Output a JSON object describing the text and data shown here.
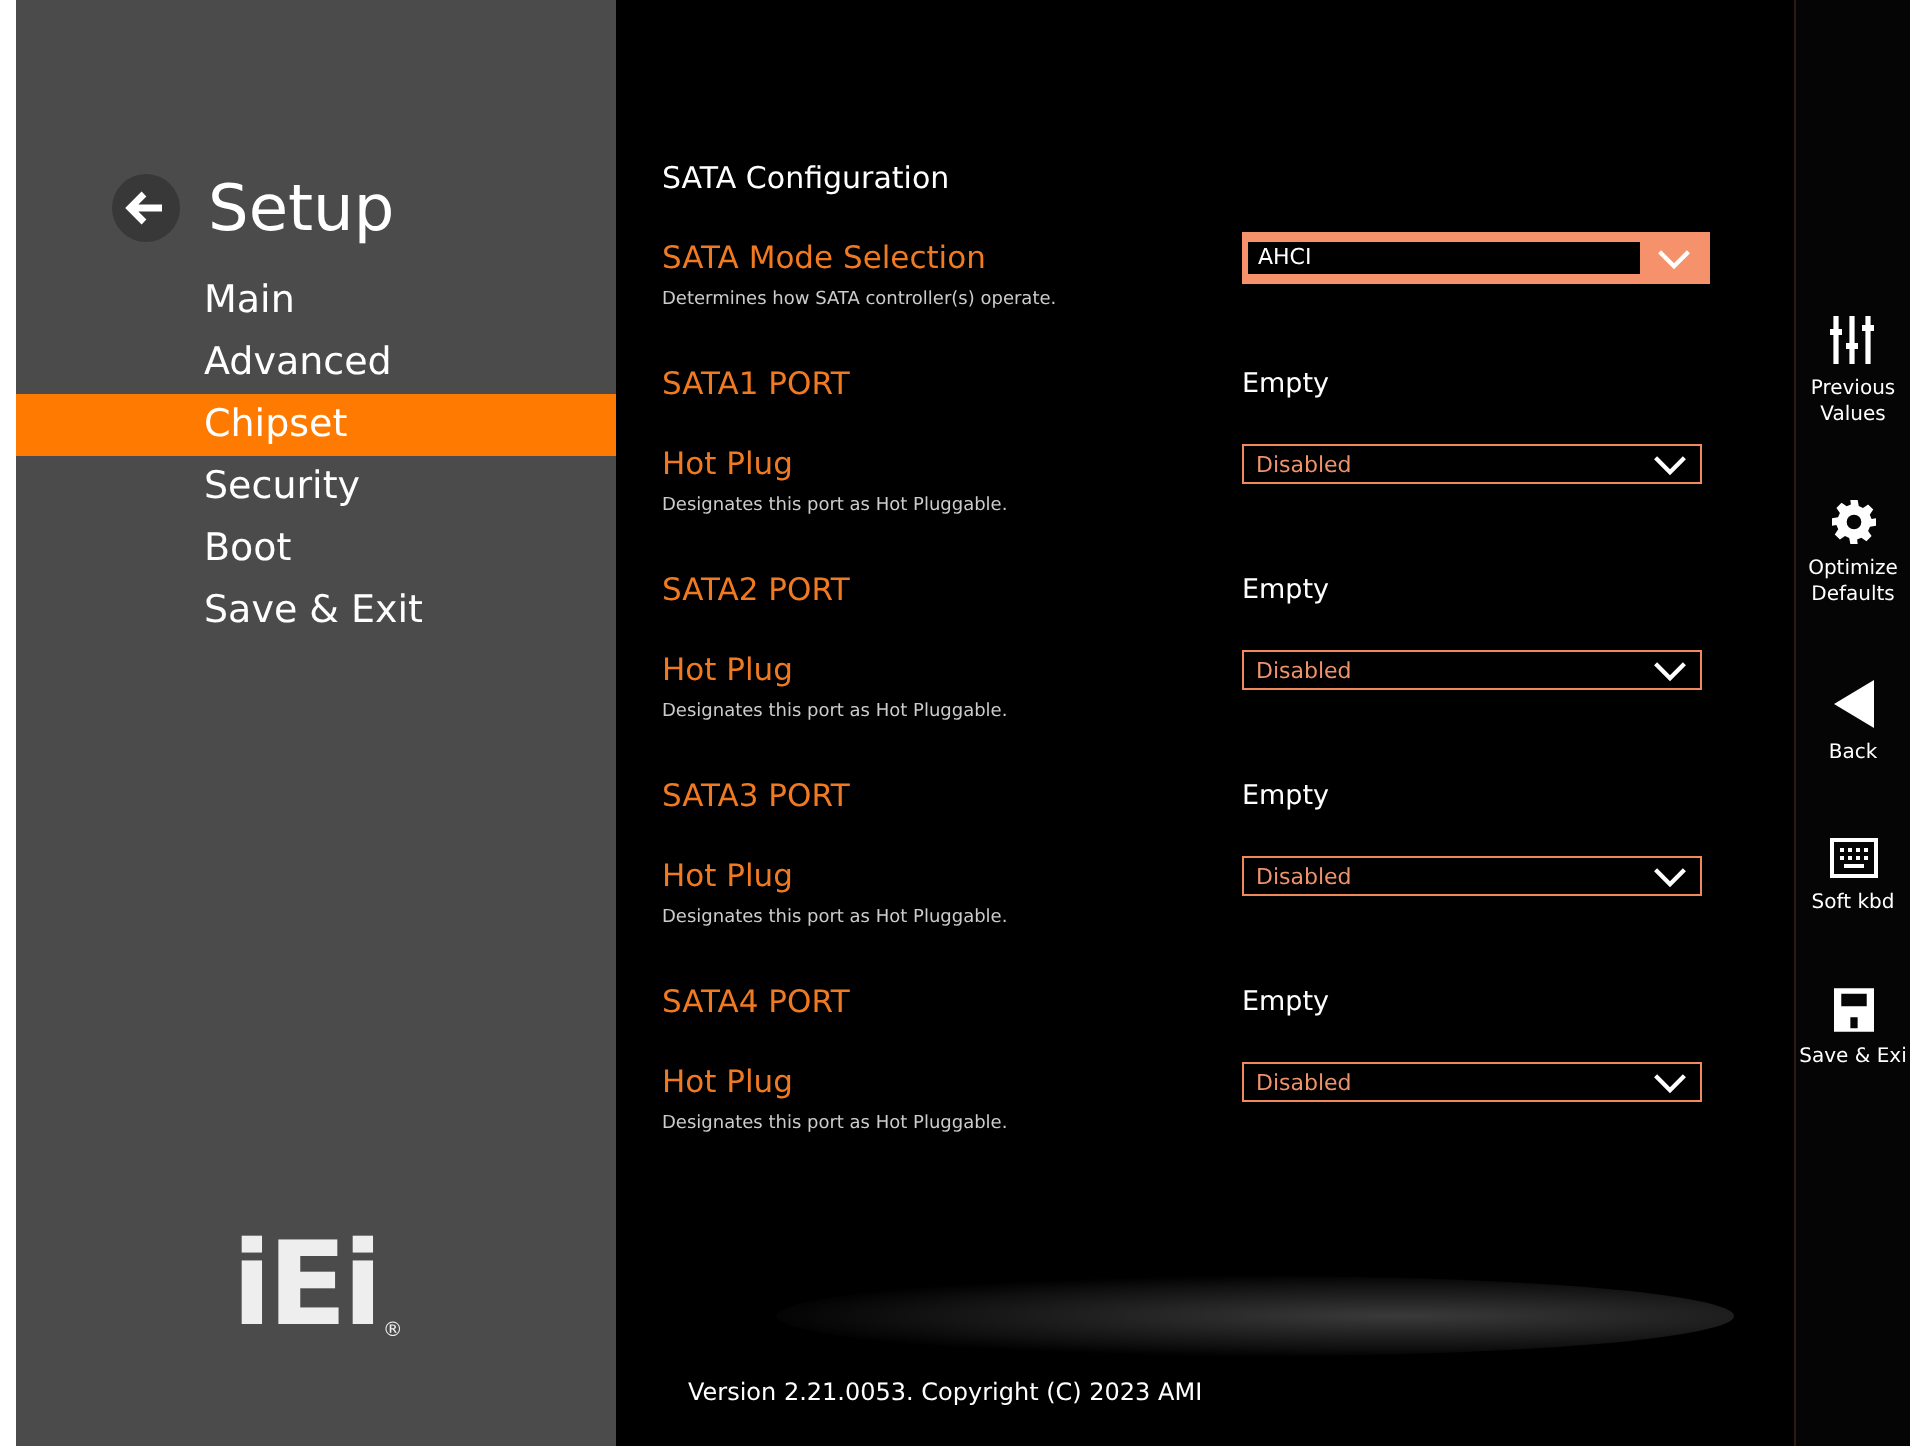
{
  "sidebar": {
    "title": "Setup",
    "items": [
      {
        "label": "Main",
        "selected": false
      },
      {
        "label": "Advanced",
        "selected": false
      },
      {
        "label": "Chipset",
        "selected": true
      },
      {
        "label": "Security",
        "selected": false
      },
      {
        "label": "Boot",
        "selected": false
      },
      {
        "label": "Save & Exit",
        "selected": false
      }
    ],
    "logo": {
      "text": "iEi",
      "mark": "®"
    }
  },
  "content": {
    "title": "SATA Configuration",
    "items": [
      {
        "kind": "select",
        "label": "SATA Mode Selection",
        "value": "AHCI",
        "help": "Determines how SATA controller(s) operate.",
        "selected": true
      },
      {
        "kind": "info",
        "label": "SATA1 PORT",
        "value": "Empty"
      },
      {
        "kind": "select",
        "label": "Hot Plug",
        "value": "Disabled",
        "help": "Designates this port as Hot Pluggable.",
        "selected": false
      },
      {
        "kind": "info",
        "label": "SATA2 PORT",
        "value": "Empty"
      },
      {
        "kind": "select",
        "label": "Hot Plug",
        "value": "Disabled",
        "help": "Designates this port as Hot Pluggable.",
        "selected": false
      },
      {
        "kind": "info",
        "label": "SATA3 PORT",
        "value": "Empty"
      },
      {
        "kind": "select",
        "label": "Hot Plug",
        "value": "Disabled",
        "help": "Designates this port as Hot Pluggable.",
        "selected": false
      },
      {
        "kind": "info",
        "label": "SATA4 PORT",
        "value": "Empty"
      },
      {
        "kind": "select",
        "label": "Hot Plug",
        "value": "Disabled",
        "help": "Designates this port as Hot Pluggable.",
        "selected": false
      }
    ],
    "footer": "Version 2.21.0053. Copyright (C) 2023 AMI"
  },
  "toolbar": [
    {
      "kind": "sliders",
      "lines": [
        "Previous",
        "Values"
      ]
    },
    {
      "kind": "gear",
      "lines": [
        "Optimize",
        "Defaults"
      ]
    },
    {
      "kind": "back",
      "lines": [
        "Back"
      ]
    },
    {
      "kind": "keyboard",
      "lines": [
        "Soft kbd"
      ]
    },
    {
      "kind": "save",
      "lines": [
        "Save & Exi"
      ]
    }
  ]
}
